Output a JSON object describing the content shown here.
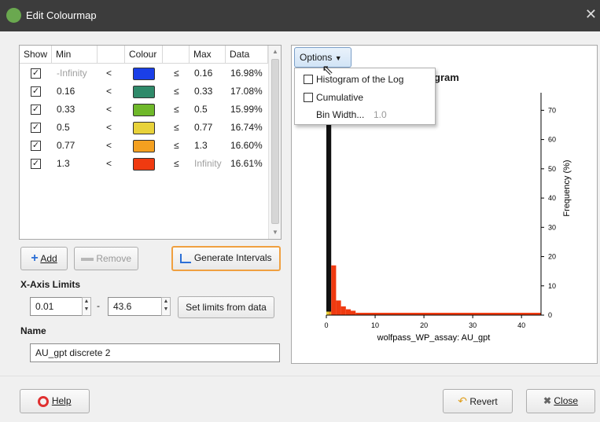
{
  "window": {
    "title": "Edit Colourmap",
    "close_glyph": "✕",
    "app_icon": "leaf-icon"
  },
  "table": {
    "headers": [
      "Show",
      "Min",
      "",
      "Colour",
      "",
      "Max",
      "Data"
    ],
    "rows": [
      {
        "show": true,
        "min": "-Infinity",
        "lt": "<",
        "colour": "#1a3fe8",
        "le": "≤",
        "max": "0.16",
        "data": "16.98%",
        "min_muted": true
      },
      {
        "show": true,
        "min": "0.16",
        "lt": "<",
        "colour": "#2f8a6a",
        "le": "≤",
        "max": "0.33",
        "data": "17.08%"
      },
      {
        "show": true,
        "min": "0.33",
        "lt": "<",
        "colour": "#6fb82a",
        "le": "≤",
        "max": "0.5",
        "data": "15.99%"
      },
      {
        "show": true,
        "min": "0.5",
        "lt": "<",
        "colour": "#e8d23a",
        "le": "≤",
        "max": "0.77",
        "data": "16.74%"
      },
      {
        "show": true,
        "min": "0.77",
        "lt": "<",
        "colour": "#f4a020",
        "le": "≤",
        "max": "1.3",
        "data": "16.60%"
      },
      {
        "show": true,
        "min": "1.3",
        "lt": "<",
        "colour": "#f03a10",
        "le": "≤",
        "max": "Infinity",
        "data": "16.61%",
        "max_muted": true
      }
    ]
  },
  "buttons": {
    "add": "Add",
    "remove": "Remove",
    "generate": "Generate Intervals",
    "set_limits": "Set limits from data",
    "help": "Help",
    "revert": "Revert",
    "close": "Close"
  },
  "xaxis": {
    "label": "X-Axis Limits",
    "min": "0.01",
    "dash": "-",
    "max": "43.6"
  },
  "name": {
    "label": "Name",
    "value": "AU_gpt discrete 2"
  },
  "options": {
    "button": "Options",
    "items": [
      {
        "label": "Histogram of the Log",
        "checked": false
      },
      {
        "label": "Cumulative",
        "checked": false
      },
      {
        "label": "Bin Width...",
        "value": "1.0"
      }
    ]
  },
  "chart_data": {
    "type": "bar",
    "title": "gram",
    "xlabel": "wolfpass_WP_assay: AU_gpt",
    "ylabel": "Frequency (%)",
    "xlim": [
      0,
      44
    ],
    "ylim": [
      0,
      76
    ],
    "xticks": [
      0,
      10,
      20,
      30,
      40
    ],
    "yticks": [
      0,
      10,
      20,
      30,
      40,
      50,
      60,
      70
    ],
    "bins": [
      {
        "x0": 0,
        "x1": 1,
        "value": 75,
        "color": "#111111"
      },
      {
        "x0": 1,
        "x1": 2,
        "value": 17,
        "color": "#f03a10"
      },
      {
        "x0": 2,
        "x1": 3,
        "value": 5,
        "color": "#f03a10"
      },
      {
        "x0": 3,
        "x1": 4,
        "value": 3,
        "color": "#f03a10"
      },
      {
        "x0": 4,
        "x1": 5,
        "value": 2,
        "color": "#f03a10"
      },
      {
        "x0": 5,
        "x1": 6,
        "value": 1.5,
        "color": "#f03a10"
      },
      {
        "x0": 6,
        "x1": 44,
        "value": 0.8,
        "color": "#f03a10"
      }
    ],
    "base_strips": [
      {
        "x0": 0,
        "x1": 0.5,
        "value": 1.2,
        "color": "#e8d23a"
      },
      {
        "x0": 0.5,
        "x1": 1,
        "value": 1.2,
        "color": "#f4a020"
      }
    ]
  }
}
